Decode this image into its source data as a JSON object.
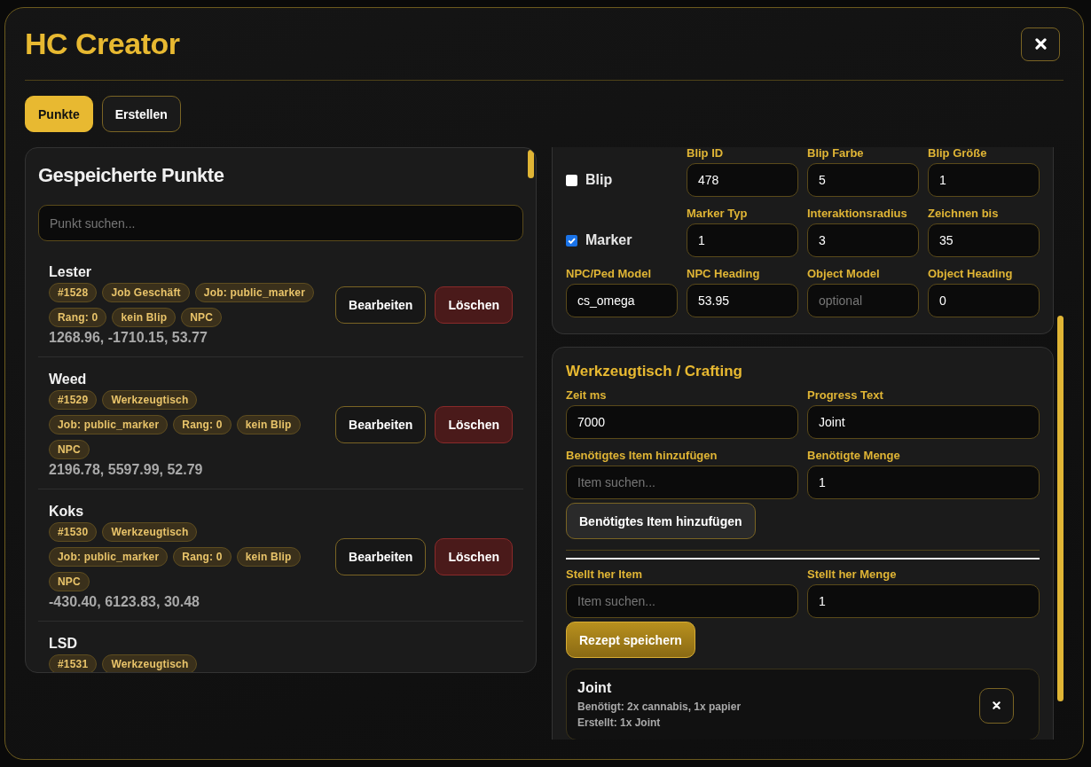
{
  "window": {
    "title": "HC Creator"
  },
  "tabs": [
    {
      "label": "Punkte",
      "selected": true
    },
    {
      "label": "Erstellen",
      "selected": false
    }
  ],
  "points_panel": {
    "title": "Gespeicherte Punkte",
    "search": {
      "placeholder": "Punkt suchen..."
    },
    "items": [
      {
        "name": "Lester",
        "tags": [
          "#1528",
          "Job Geschäft",
          "Job: public_marker",
          "Rang: 0",
          "kein Blip",
          "NPC"
        ],
        "coords": "1268.96, -1710.15, 53.77",
        "actions": [
          {
            "label": "Bearbeiten",
            "kind": "edit"
          },
          {
            "label": "Löschen",
            "kind": "delete"
          }
        ]
      },
      {
        "name": "Weed",
        "tags": [
          "#1529",
          "Werkzeugtisch",
          "Job: public_marker",
          "Rang: 0",
          "kein Blip",
          "NPC"
        ],
        "coords": "2196.78, 5597.99, 52.79",
        "actions": [
          {
            "label": "Bearbeiten",
            "kind": "edit"
          },
          {
            "label": "Löschen",
            "kind": "delete"
          }
        ]
      },
      {
        "name": "Koks",
        "tags": [
          "#1530",
          "Werkzeugtisch",
          "Job: public_marker",
          "Rang: 0",
          "kein Blip",
          "NPC"
        ],
        "coords": "-430.40, 6123.83, 30.48",
        "actions": [
          {
            "label": "Bearbeiten",
            "kind": "edit"
          },
          {
            "label": "Löschen",
            "kind": "delete"
          }
        ]
      },
      {
        "name": "LSD",
        "tags": [
          "#1531",
          "Werkzeugtisch"
        ]
      }
    ]
  },
  "settings_card": {
    "toggle_rows": [
      {
        "label": "Blip",
        "checked": false,
        "fields": [
          {
            "label": "Blip ID",
            "value": "478"
          },
          {
            "label": "Blip Farbe",
            "value": "5"
          },
          {
            "label": "Blip Größe",
            "value": "1"
          }
        ]
      },
      {
        "label": "Marker",
        "checked": true,
        "fields": [
          {
            "label": "Marker Typ",
            "value": "1"
          },
          {
            "label": "Interaktionsradius",
            "value": "3"
          },
          {
            "label": "Zeichnen bis",
            "value": "35"
          }
        ]
      }
    ],
    "model_fields": [
      {
        "label": "NPC/Ped Model",
        "value": "cs_omega"
      },
      {
        "label": "NPC Heading",
        "value": "53.95"
      },
      {
        "label": "Object Model",
        "placeholder": "optional"
      },
      {
        "label": "Object Heading",
        "value": "0"
      }
    ]
  },
  "crafting": {
    "title": "Werkzeugtisch / Crafting",
    "fields": [
      {
        "label": "Zeit ms",
        "value": "7000"
      },
      {
        "label": "Progress Text",
        "value": "Joint"
      },
      {
        "label": "Benötigtes Item hinzufügen",
        "placeholder": "Item suchen..."
      },
      {
        "label": "Benötigte Menge",
        "value": "1"
      }
    ],
    "add_button": "Benötigtes Item hinzufügen",
    "output_fields": [
      {
        "label": "Stellt her Item",
        "placeholder": "Item suchen..."
      },
      {
        "label": "Stellt her Menge",
        "value": "1"
      }
    ],
    "save_button": "Rezept speichern",
    "recipes": [
      {
        "name": "Joint",
        "lines": [
          "Benötigt: 2x cannabis, 1x papier",
          "Erstellt: 1x Joint"
        ]
      }
    ]
  }
}
